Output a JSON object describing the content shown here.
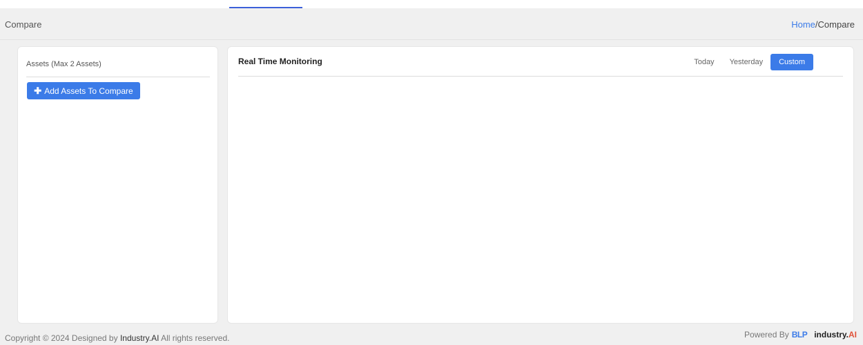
{
  "header": {
    "title": "Compare",
    "breadcrumb": {
      "home": "Home",
      "separator": "/",
      "current": "Compare"
    }
  },
  "assets_panel": {
    "title": "Assets (Max 2 Assets)",
    "add_button_label": "Add Assets To Compare",
    "add_button_icon": "plus-icon"
  },
  "monitoring_panel": {
    "title": "Real Time Monitoring",
    "range_tabs": [
      {
        "label": "Today",
        "active": false
      },
      {
        "label": "Yesterday",
        "active": false
      },
      {
        "label": "Custom",
        "active": true
      }
    ]
  },
  "footer": {
    "copyright_prefix": "Copyright © 2024 Designed by",
    "brand": "Industry.AI",
    "copyright_suffix": "All rights reserved.",
    "powered_by": "Powered By",
    "logo_blp": "BLP",
    "logo_industry": "industry.",
    "logo_ai": "AI"
  },
  "colors": {
    "accent": "#3b7be8",
    "page_bg": "#f0f0f0",
    "card_bg": "#ffffff",
    "ai_accent": "#e0533a"
  }
}
